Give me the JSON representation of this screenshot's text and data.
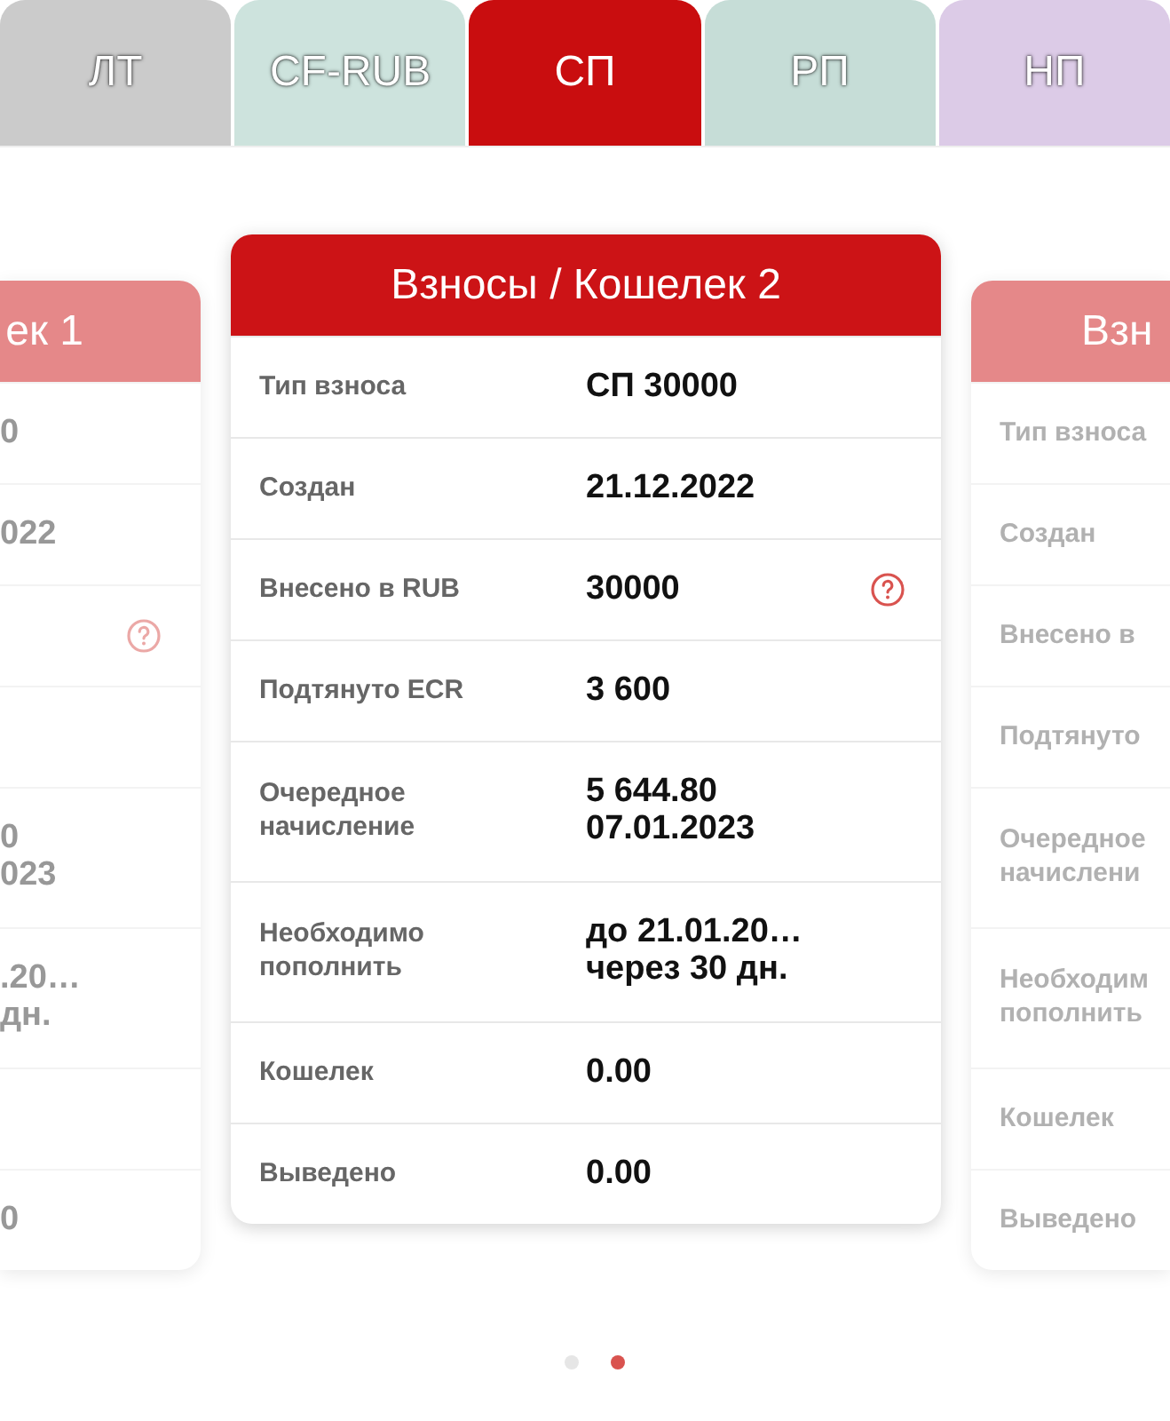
{
  "tabs": [
    {
      "label": "ЛТ",
      "selected": false,
      "color": "#cbcbcb"
    },
    {
      "label": "CF-RUB",
      "selected": false,
      "color": "#cde3dd"
    },
    {
      "label": "СП",
      "selected": true,
      "color": "#c90d0f"
    },
    {
      "label": "РП",
      "selected": false,
      "color": "#c6ddd7"
    },
    {
      "label": "НП",
      "selected": false,
      "color": "#dccbe7"
    }
  ],
  "slides": [
    {
      "selected": false,
      "title": "ек 1",
      "rows": [
        {
          "value": [
            "0"
          ]
        },
        {
          "value": [
            "022"
          ]
        },
        {
          "help": true
        },
        {},
        {
          "value": [
            "0",
            "023"
          ]
        },
        {
          "value": [
            ".20…",
            "дн."
          ]
        },
        {},
        {
          "value": [
            "0"
          ]
        }
      ]
    },
    {
      "selected": true,
      "title": "Взносы / Кошелек 2",
      "rows": [
        {
          "label": [
            "Тип взноса"
          ],
          "value": [
            "СП 30000"
          ]
        },
        {
          "label": [
            "Создан"
          ],
          "value": [
            "21.12.2022"
          ]
        },
        {
          "label": [
            "Внесено в RUB"
          ],
          "value": [
            "30000"
          ],
          "help": true
        },
        {
          "label": [
            "Подтянуто ECR"
          ],
          "value": [
            "3 600"
          ]
        },
        {
          "label": [
            "Очередное",
            "начисление"
          ],
          "value": [
            "5 644.80",
            "07.01.2023"
          ]
        },
        {
          "label": [
            "Необходимо",
            "пополнить"
          ],
          "value": [
            "до 21.01.20…",
            "через 30 дн."
          ]
        },
        {
          "label": [
            "Кошелек"
          ],
          "value": [
            "0.00"
          ]
        },
        {
          "label": [
            "Выведено"
          ],
          "value": [
            "0.00"
          ]
        }
      ]
    },
    {
      "selected": false,
      "title": "Взн",
      "rows": [
        {
          "label": [
            "Тип взноса"
          ]
        },
        {
          "label": [
            "Создан"
          ]
        },
        {
          "label": [
            "Внесено в"
          ]
        },
        {
          "label": [
            "Подтянуто"
          ]
        },
        {
          "label": [
            "Очередное",
            "начислени"
          ]
        },
        {
          "label": [
            "Необходим",
            "пополнить"
          ]
        },
        {
          "label": [
            "Кошелек"
          ]
        },
        {
          "label": [
            "Выведено"
          ]
        }
      ]
    }
  ],
  "dots": [
    {
      "selected": false
    },
    {
      "selected": true
    }
  ]
}
